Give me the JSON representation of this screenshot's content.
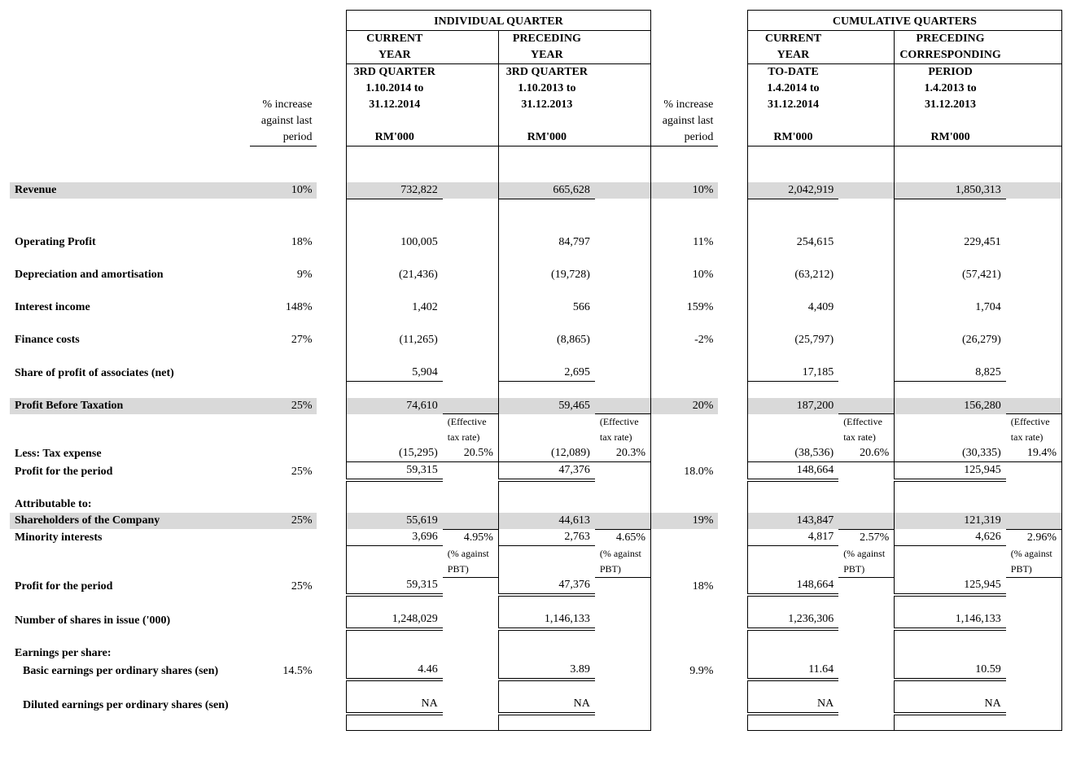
{
  "headers": {
    "individual_quarter": "INDIVIDUAL QUARTER",
    "cumulative_quarters": "CUMULATIVE QUARTERS",
    "current_year": "CURRENT",
    "year": "YEAR",
    "preceding": "PRECEDING",
    "corresponding": "CORRESPONDING",
    "third_quarter": "3RD QUARTER",
    "to_date": "TO-DATE",
    "period_label": "PERIOD",
    "ind_curr_range1": "1.10.2014 to",
    "ind_curr_range2": "31.12.2014",
    "ind_prec_range1": "1.10.2013 to",
    "ind_prec_range2": "31.12.2013",
    "cum_curr_range1": "1.4.2014 to",
    "cum_curr_range2": "31.12.2014",
    "cum_prec_range1": "1.4.2013 to",
    "cum_prec_range2": "31.12.2013",
    "pct_increase": "% increase",
    "against_last": "against last",
    "period_word": "period",
    "rm000": "RM'000",
    "eff_tax_rate1": "(Effective",
    "eff_tax_rate2": "tax rate)",
    "pct_against": "(% against",
    "pbt": "PBT)"
  },
  "rows": {
    "revenue": {
      "label": "Revenue",
      "pct_ind": "10%",
      "ind_curr": "732,822",
      "ind_prec": "665,628",
      "pct_cum": "10%",
      "cum_curr": "2,042,919",
      "cum_prec": "1,850,313"
    },
    "op_profit": {
      "label": "Operating Profit",
      "pct_ind": "18%",
      "ind_curr": "100,005",
      "ind_prec": "84,797",
      "pct_cum": "11%",
      "cum_curr": "254,615",
      "cum_prec": "229,451"
    },
    "dep_amort": {
      "label": "Depreciation and amortisation",
      "pct_ind": "9%",
      "ind_curr": "(21,436)",
      "ind_prec": "(19,728)",
      "pct_cum": "10%",
      "cum_curr": "(63,212)",
      "cum_prec": "(57,421)"
    },
    "int_income": {
      "label": "Interest income",
      "pct_ind": "148%",
      "ind_curr": "1,402",
      "ind_prec": "566",
      "pct_cum": "159%",
      "cum_curr": "4,409",
      "cum_prec": "1,704"
    },
    "fin_costs": {
      "label": "Finance costs",
      "pct_ind": "27%",
      "ind_curr": "(11,265)",
      "ind_prec": "(8,865)",
      "pct_cum": "-2%",
      "cum_curr": "(25,797)",
      "cum_prec": "(26,279)"
    },
    "share_assoc": {
      "label": "Share of profit of associates (net)",
      "pct_ind": "",
      "ind_curr": "5,904",
      "ind_prec": "2,695",
      "pct_cum": "",
      "cum_curr": "17,185",
      "cum_prec": "8,825"
    },
    "pbt": {
      "label": "Profit Before Taxation",
      "pct_ind": "25%",
      "ind_curr": "74,610",
      "ind_prec": "59,465",
      "pct_cum": "20%",
      "cum_curr": "187,200",
      "cum_prec": "156,280"
    },
    "tax": {
      "label": "Less: Tax expense",
      "ind_curr": "(15,295)",
      "ind_curr_rate": "20.5%",
      "ind_prec": "(12,089)",
      "ind_prec_rate": "20.3%",
      "cum_curr": "(38,536)",
      "cum_curr_rate": "20.6%",
      "cum_prec": "(30,335)",
      "cum_prec_rate": "19.4%"
    },
    "profit_period": {
      "label": "Profit for the period",
      "pct_ind": "25%",
      "ind_curr": "59,315",
      "ind_prec": "47,376",
      "pct_cum": "18.0%",
      "cum_curr": "148,664",
      "cum_prec": "125,945"
    },
    "attrib": {
      "label": "Attributable to:"
    },
    "shareholders": {
      "label": "Shareholders of the Company",
      "pct_ind": "25%",
      "ind_curr": "55,619",
      "ind_prec": "44,613",
      "pct_cum": "19%",
      "cum_curr": "143,847",
      "cum_prec": "121,319"
    },
    "minority": {
      "label": "Minority interests",
      "ind_curr": "3,696",
      "ind_curr_rate": "4.95%",
      "ind_prec": "2,763",
      "ind_prec_rate": "4.65%",
      "cum_curr": "4,817",
      "cum_curr_rate": "2.57%",
      "cum_prec": "4,626",
      "cum_prec_rate": "2.96%"
    },
    "profit_period2": {
      "label": "Profit for the period",
      "pct_ind": "25%",
      "ind_curr": "59,315",
      "ind_prec": "47,376",
      "pct_cum": "18%",
      "cum_curr": "148,664",
      "cum_prec": "125,945"
    },
    "num_shares": {
      "label": "Number of shares in issue ('000)",
      "ind_curr": "1,248,029",
      "ind_prec": "1,146,133",
      "cum_curr": "1,236,306",
      "cum_prec": "1,146,133"
    },
    "eps_label": {
      "label": "Earnings per share:"
    },
    "basic_eps": {
      "label": "  Basic earnings per ordinary shares (sen)",
      "pct_ind": "14.5%",
      "ind_curr": "4.46",
      "ind_prec": "3.89",
      "pct_cum": "9.9%",
      "cum_curr": "11.64",
      "cum_prec": "10.59"
    },
    "diluted_eps": {
      "label": "  Diluted earnings per ordinary shares (sen)",
      "ind_curr": "NA",
      "ind_prec": "NA",
      "cum_curr": "NA",
      "cum_prec": "NA"
    }
  }
}
